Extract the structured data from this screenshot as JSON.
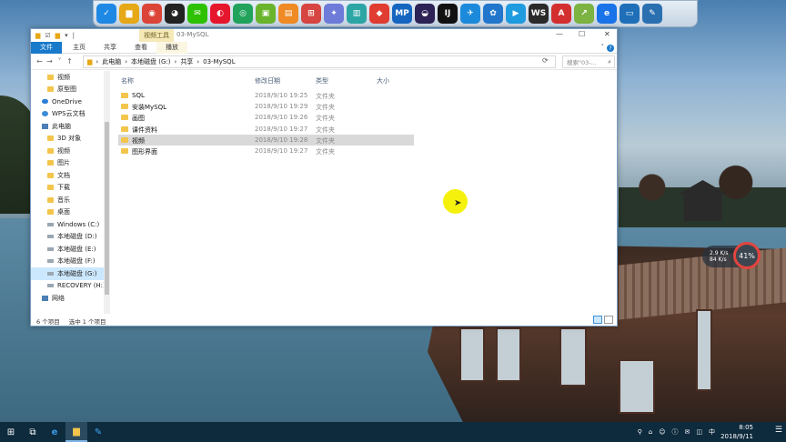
{
  "window": {
    "context_tab": "视频工具",
    "title": "03-MySQL",
    "tabs": [
      "文件",
      "主页",
      "共享",
      "查看",
      "播放"
    ],
    "minimize": "—",
    "maximize": "☐",
    "close": "✕",
    "help": "?",
    "expand": "˅"
  },
  "address": {
    "back": "←",
    "forward": "→",
    "recent": "˅",
    "up": "↑",
    "crumbs": [
      "此电脑",
      "本地磁盘 (G:)",
      "共享",
      "03-MySQL"
    ],
    "separator": "›",
    "refresh": "⟳",
    "search_placeholder": "搜索\"03-...",
    "search_icon": "⌕"
  },
  "nav": {
    "items": [
      {
        "label": "视频",
        "icon": "folder-icon",
        "indent": 1
      },
      {
        "label": "原型图",
        "icon": "folder-icon",
        "indent": 1
      },
      {
        "label": "OneDrive",
        "icon": "cloud-icon",
        "indent": 0
      },
      {
        "label": "WPS云文档",
        "icon": "wps-icon",
        "indent": 0
      },
      {
        "label": "此电脑",
        "icon": "pc-icon",
        "indent": 0
      },
      {
        "label": "3D 对象",
        "icon": "folder-icon",
        "indent": 1
      },
      {
        "label": "视频",
        "icon": "folder-icon",
        "indent": 1
      },
      {
        "label": "图片",
        "icon": "folder-icon",
        "indent": 1
      },
      {
        "label": "文档",
        "icon": "folder-icon",
        "indent": 1
      },
      {
        "label": "下载",
        "icon": "folder-icon",
        "indent": 1
      },
      {
        "label": "音乐",
        "icon": "folder-icon",
        "indent": 1
      },
      {
        "label": "桌面",
        "icon": "folder-icon",
        "indent": 1
      },
      {
        "label": "Windows (C:)",
        "icon": "drive-icon",
        "indent": 1
      },
      {
        "label": "本地磁盘 (D:)",
        "icon": "drive-icon",
        "indent": 1
      },
      {
        "label": "本地磁盘 (E:)",
        "icon": "drive-icon",
        "indent": 1
      },
      {
        "label": "本地磁盘 (F:)",
        "icon": "drive-icon",
        "indent": 1
      },
      {
        "label": "本地磁盘 (G:)",
        "icon": "drive-icon",
        "indent": 1,
        "selected": true
      },
      {
        "label": "RECOVERY (H:)",
        "icon": "drive-icon",
        "indent": 1
      },
      {
        "label": "网络",
        "icon": "network-icon",
        "indent": 0
      }
    ]
  },
  "columns": {
    "name": "名称",
    "date": "修改日期",
    "type": "类型",
    "size": "大小"
  },
  "files": [
    {
      "name": "SQL",
      "date": "2018/9/10 19:25",
      "type": "文件夹"
    },
    {
      "name": "安装MySQL",
      "date": "2018/9/10 19:29",
      "type": "文件夹"
    },
    {
      "name": "画图",
      "date": "2018/9/10 19:26",
      "type": "文件夹"
    },
    {
      "name": "课件资料",
      "date": "2018/9/10 19:27",
      "type": "文件夹"
    },
    {
      "name": "视频",
      "date": "2018/9/10 19:28",
      "type": "文件夹",
      "selected": true
    },
    {
      "name": "图形界面",
      "date": "2018/9/10 19:27",
      "type": "文件夹"
    }
  ],
  "status": {
    "count": "6 个项目",
    "selected": "选中 1 个项目"
  },
  "netwidget": {
    "up": "2.9 K/s",
    "down": "84 K/s",
    "percent": "41%"
  },
  "dock": {
    "icons": [
      {
        "name": "shield-icon",
        "color": "#1e88e5",
        "glyph": "✓"
      },
      {
        "name": "folder-icon",
        "color": "#e6a817",
        "glyph": "▆"
      },
      {
        "name": "chrome-icon",
        "color": "#db4437",
        "glyph": "◉"
      },
      {
        "name": "qq-icon",
        "color": "#222222",
        "glyph": "◕"
      },
      {
        "name": "wechat-icon",
        "color": "#2dc100",
        "glyph": "✉"
      },
      {
        "name": "weibo-icon",
        "color": "#e6162d",
        "glyph": "◐"
      },
      {
        "name": "green-app-icon",
        "color": "#21a35b",
        "glyph": "◎"
      },
      {
        "name": "cube-icon",
        "color": "#6ab42d",
        "glyph": "▣"
      },
      {
        "name": "orange-app-icon",
        "color": "#f08a24",
        "glyph": "▤"
      },
      {
        "name": "red-app-icon",
        "color": "#d64541",
        "glyph": "⊞"
      },
      {
        "name": "swirl-icon",
        "color": "#6f7bd9",
        "glyph": "✦"
      },
      {
        "name": "notes-icon",
        "color": "#2ca5a5",
        "glyph": "▥"
      },
      {
        "name": "kite-icon",
        "color": "#e03c31",
        "glyph": "◆"
      },
      {
        "name": "mp-icon",
        "color": "#1565c0",
        "glyph": "MP"
      },
      {
        "name": "eclipse-icon",
        "color": "#2c2255",
        "glyph": "◒"
      },
      {
        "name": "intellij-icon",
        "color": "#111111",
        "glyph": "IJ"
      },
      {
        "name": "bird-icon",
        "color": "#1c8adb",
        "glyph": "✈"
      },
      {
        "name": "share-icon",
        "color": "#2277cc",
        "glyph": "✿"
      },
      {
        "name": "media-icon",
        "color": "#1f9be0",
        "glyph": "▶"
      },
      {
        "name": "ws-icon",
        "color": "#2a2a2a",
        "glyph": "WS"
      },
      {
        "name": "pdf-icon",
        "color": "#d32f2f",
        "glyph": "A"
      },
      {
        "name": "chart-icon",
        "color": "#7cb342",
        "glyph": "↗"
      },
      {
        "name": "ie-icon",
        "color": "#1a73e8",
        "glyph": "e"
      },
      {
        "name": "monitor-icon",
        "color": "#1e6fb8",
        "glyph": "▭"
      },
      {
        "name": "tools-icon",
        "color": "#2a6fb0",
        "glyph": "✎"
      }
    ]
  },
  "taskbar": {
    "start": "⊞",
    "taskview": "⧉",
    "time": "8:05",
    "date": "2018/9/11",
    "ime": "中",
    "notification": "☰",
    "tray_icons": [
      "⚲",
      "⌂",
      "☺",
      "ⓘ",
      "✉",
      "◫"
    ]
  }
}
